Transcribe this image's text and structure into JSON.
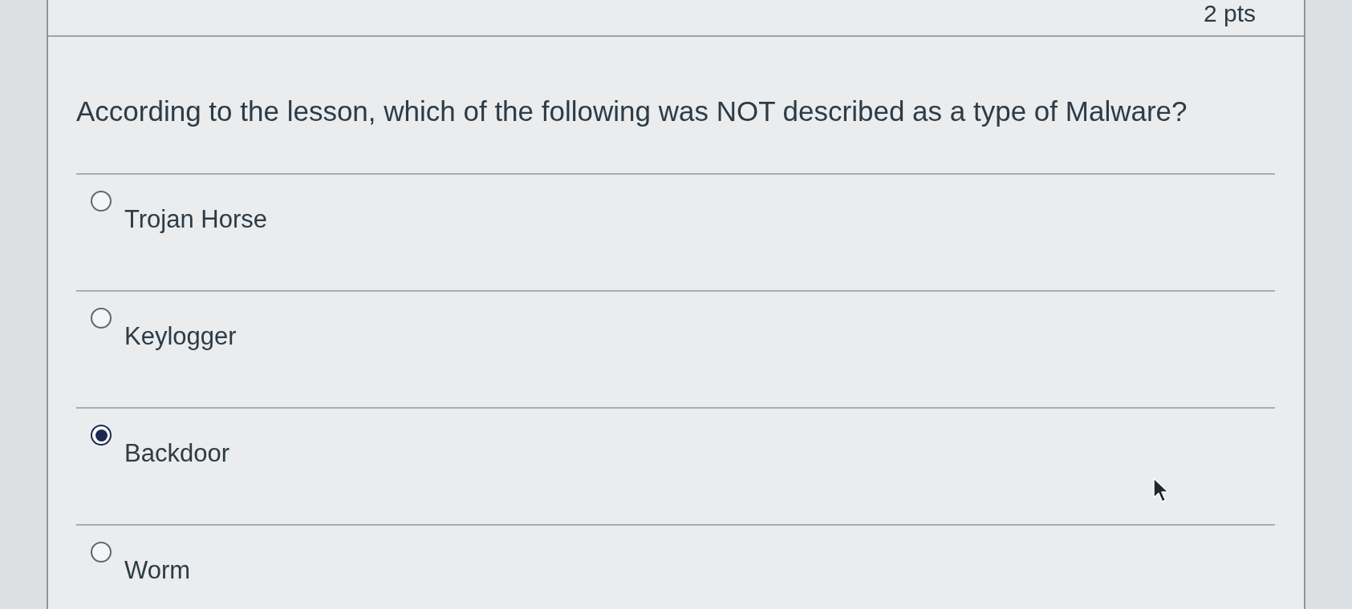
{
  "question": {
    "points": "2 pts",
    "text": "According to the lesson, which of the following was NOT described as a type of Malware?"
  },
  "options": [
    {
      "label": "Trojan Horse",
      "selected": false
    },
    {
      "label": "Keylogger",
      "selected": false
    },
    {
      "label": "Backdoor",
      "selected": true
    },
    {
      "label": "Worm",
      "selected": false
    }
  ]
}
